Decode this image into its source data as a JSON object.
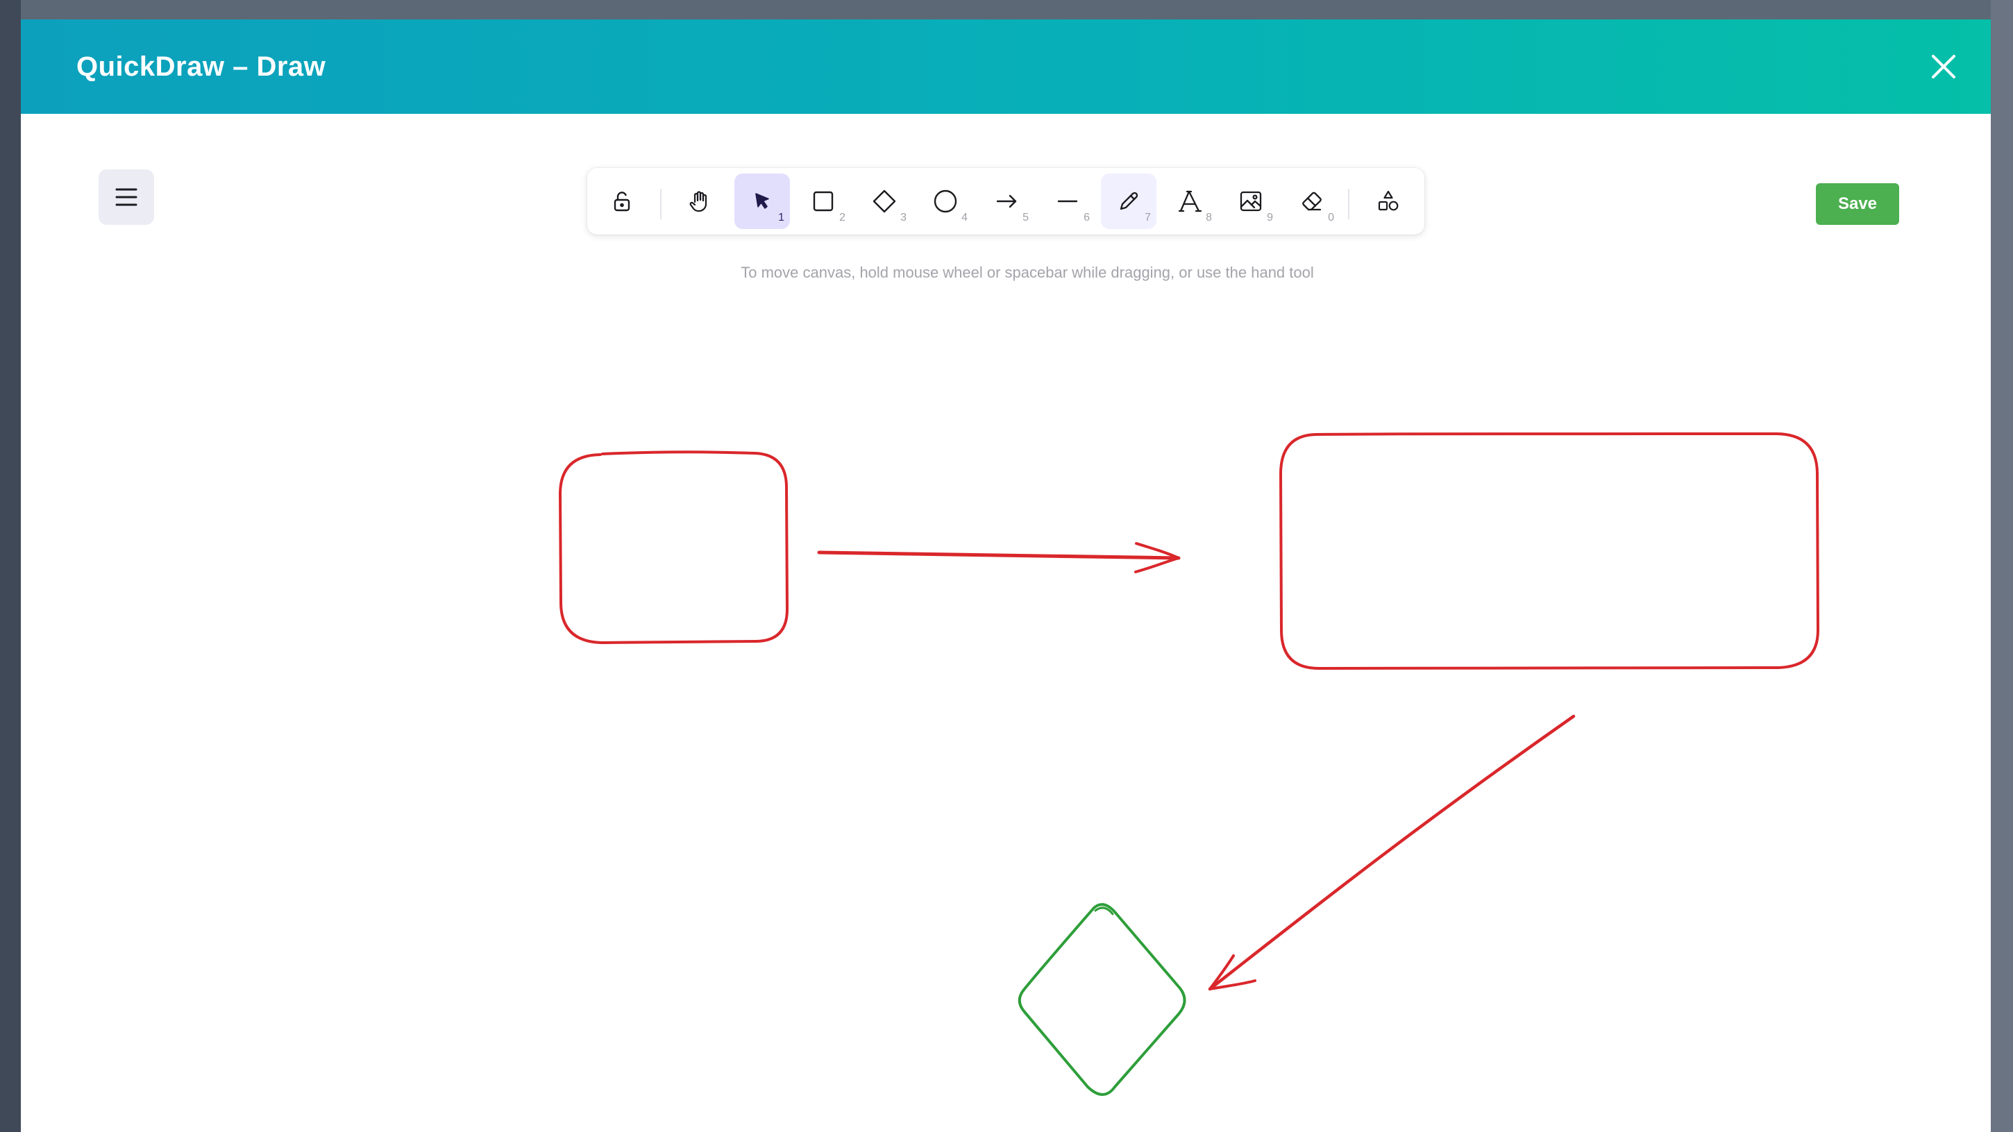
{
  "window": {
    "title": "QuickDraw – Draw"
  },
  "toolbar": {
    "tools": [
      {
        "name": "lock",
        "icon": "unlock-icon",
        "key": ""
      },
      {
        "name": "hand",
        "icon": "hand-icon",
        "key": ""
      },
      {
        "name": "selection",
        "icon": "pointer-icon",
        "key": "1",
        "selected": true
      },
      {
        "name": "rectangle",
        "icon": "square-icon",
        "key": "2"
      },
      {
        "name": "diamond",
        "icon": "diamond-icon",
        "key": "3"
      },
      {
        "name": "ellipse",
        "icon": "circle-icon",
        "key": "4"
      },
      {
        "name": "arrow",
        "icon": "arrow-right-icon",
        "key": "5"
      },
      {
        "name": "line",
        "icon": "line-icon",
        "key": "6"
      },
      {
        "name": "draw",
        "icon": "pencil-icon",
        "key": "7",
        "active": true
      },
      {
        "name": "text",
        "icon": "text-icon",
        "key": "8"
      },
      {
        "name": "image",
        "icon": "image-icon",
        "key": "9"
      },
      {
        "name": "eraser",
        "icon": "eraser-icon",
        "key": "0"
      },
      {
        "name": "more-shapes",
        "icon": "shapes-icon",
        "key": ""
      }
    ]
  },
  "actions": {
    "save_label": "Save"
  },
  "hint": "To move canvas, hold mouse wheel or spacebar while dragging, or use the hand tool",
  "canvas": {
    "elements": [
      {
        "type": "rectangle",
        "stroke": "#d9272b",
        "label": ""
      },
      {
        "type": "arrow",
        "stroke": "#d9272b",
        "direction": "right"
      },
      {
        "type": "rectangle",
        "stroke": "#d9272b",
        "label": ""
      },
      {
        "type": "arrow",
        "stroke": "#d9272b",
        "direction": "down-left"
      },
      {
        "type": "diamond",
        "stroke": "#2e9e3a",
        "label": ""
      }
    ]
  },
  "colors": {
    "header_gradient_start": "#0ca0bd",
    "header_gradient_end": "#05bfa8",
    "save_button": "#4caf50",
    "selected_tool": "#e2dffd",
    "shape_red": "#d9272b",
    "shape_green": "#2e9e3a"
  }
}
